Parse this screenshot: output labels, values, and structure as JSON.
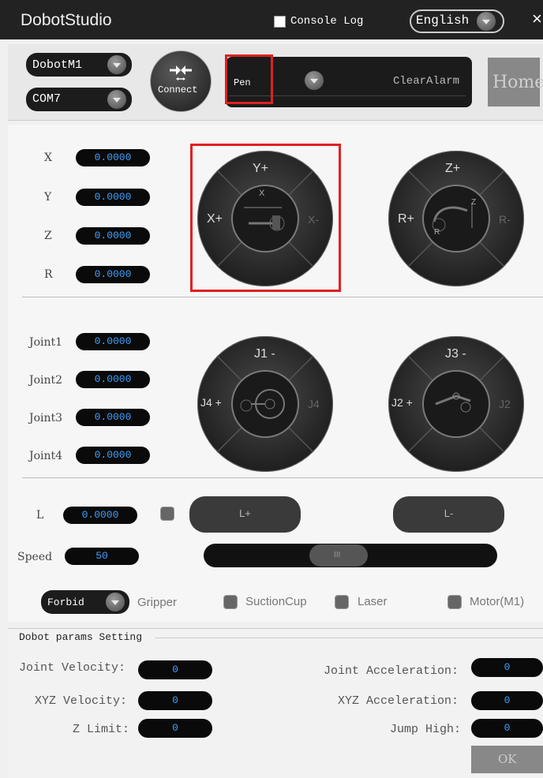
{
  "window": {
    "title": "DobotStudio",
    "console_log_label": "Console Log",
    "language": "English",
    "close_glyph": "×"
  },
  "toolbar": {
    "device": "DobotM1",
    "port": "COM7",
    "connect_label": "Connect",
    "end_tool": "Pen",
    "clear_alarm_label": "ClearAlarm",
    "home_label": "Home"
  },
  "cartesian": {
    "rows": [
      {
        "label": "X",
        "value": "0.0000"
      },
      {
        "label": "Y",
        "value": "0.0000"
      },
      {
        "label": "Z",
        "value": "0.0000"
      },
      {
        "label": "R",
        "value": "0.0000"
      }
    ],
    "xy_dial": {
      "top": "Y+",
      "left": "X+",
      "right": "X-",
      "hub_label": "X"
    },
    "zr_dial": {
      "top": "Z+",
      "left": "R+",
      "right": "R-",
      "hub_label": "Z",
      "hub_sub": "R"
    }
  },
  "joints": {
    "rows": [
      {
        "label": "Joint1",
        "value": "0.0000"
      },
      {
        "label": "Joint2",
        "value": "0.0000"
      },
      {
        "label": "Joint3",
        "value": "0.0000"
      },
      {
        "label": "Joint4",
        "value": "0.0000"
      }
    ],
    "j14_dial": {
      "top": "J1 -",
      "left": "J4 +",
      "right": "J4"
    },
    "j23_dial": {
      "top": "J3 -",
      "left": "J2 +",
      "right": "J2"
    }
  },
  "linear": {
    "l_label": "L",
    "l_value": "0.0000",
    "l_plus": "L+",
    "l_minus": "L-",
    "speed_label": "Speed",
    "speed_value": "50",
    "speed_fraction": 0.45
  },
  "end_effector": {
    "mode": "Forbid",
    "gripper_label": "Gripper",
    "suction_label": "SuctionCup",
    "laser_label": "Laser",
    "motor_label": "Motor(M1)"
  },
  "params": {
    "title": "Dobot params Setting",
    "joint_velocity_label": "Joint Velocity:",
    "joint_velocity": "0",
    "xyz_velocity_label": "XYZ Velocity:",
    "xyz_velocity": "0",
    "z_limit_label": "Z Limit:",
    "z_limit": "0",
    "joint_accel_label": "Joint Acceleration:",
    "joint_accel": "0",
    "xyz_accel_label": "XYZ Acceleration:",
    "xyz_accel": "0",
    "jump_high_label": "Jump High:",
    "jump_high": "0",
    "ok_label": "OK"
  }
}
